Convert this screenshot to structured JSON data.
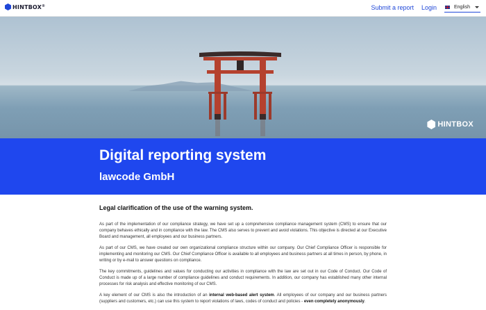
{
  "brand": {
    "name": "HINTBOX",
    "mark": "®"
  },
  "nav": {
    "submit_report": "Submit a report",
    "login": "Login",
    "language": "English"
  },
  "hero": {
    "logo_text": "HINTBOX"
  },
  "banner": {
    "title": "Digital reporting system",
    "company": "lawcode GmbH"
  },
  "content": {
    "heading": "Legal clarification of the use of the warning system.",
    "paragraphs": [
      "As part of the implementation of our compliance strategy, we have set up a comprehensive compliance management system (CMS) to ensure that our company behaves ethically and in compliance with the law. The CMS also serves to prevent and avoid violations. This objective is directed at our Executive Board and management, all employees and our business partners.",
      "As part of our CMS, we have created our own organizational compliance structure within our company. Our Chief Compliance Officer is responsible for implementing and monitoring our CMS. Our Chief Compliance Officer is available to all employees and business partners at all times in person, by phone, in writing or by e-mail to answer questions on compliance.",
      "The key commitments, guidelines and values for conducting our activities in compliance with the law are set out in our Code of Conduct. Our Code of Conduct is made up of a large number of compliance guidelines and conduct requirements. In addition, our company has established many other internal processes for risk analysis and effective monitoring of our CMS."
    ],
    "last_paragraph": {
      "part1": "A key element of our CMS is also the introduction of an ",
      "bold1": "internal web-based alert system",
      "part2": ". All employees of our company and our business partners (suppliers and customers, etc.) can use this system to report violations of laws, codes of conduct and policies - ",
      "bold2": "even completely anonymously",
      "part3": "."
    }
  },
  "colors": {
    "accent": "#1f47ee",
    "link": "#1f47d8",
    "torii": "#b5412e"
  },
  "icons": {
    "language_flag": "uk-flag-icon",
    "dropdown": "chevron-down-icon",
    "brand": "hexagon-logo-icon"
  }
}
